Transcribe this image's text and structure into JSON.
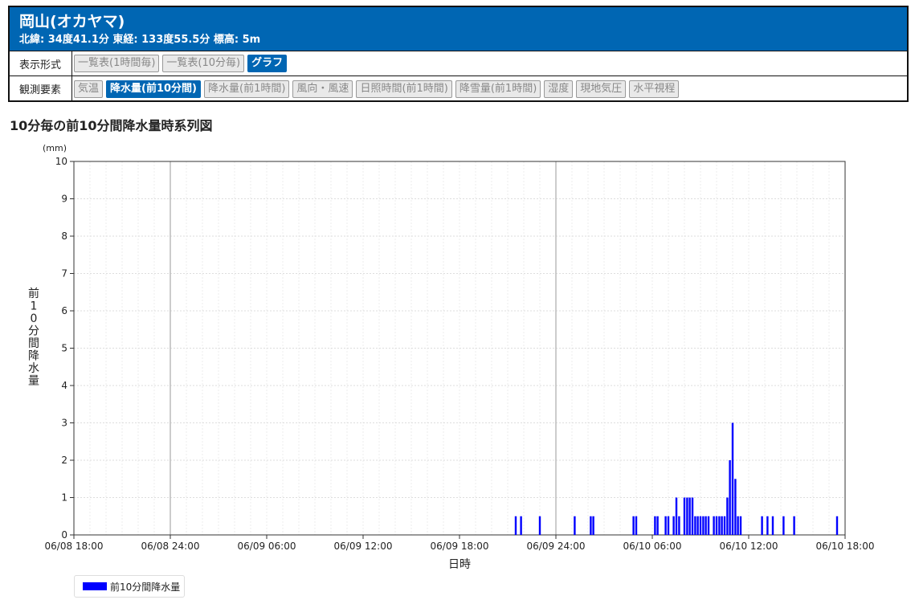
{
  "header": {
    "title": "岡山(オカヤマ)",
    "coords": "北緯: 34度41.1分 東経: 133度55.5分 標高: 5m"
  },
  "display_format": {
    "label": "表示形式",
    "buttons": [
      {
        "label": "一覧表(1時間毎)",
        "active": false
      },
      {
        "label": "一覧表(10分毎)",
        "active": false
      },
      {
        "label": "グラフ",
        "active": true
      }
    ]
  },
  "elements": {
    "label": "観測要素",
    "buttons": [
      {
        "label": "気温",
        "active": false
      },
      {
        "label": "降水量(前10分間)",
        "active": true
      },
      {
        "label": "降水量(前1時間)",
        "active": false
      },
      {
        "label": "風向・風速",
        "active": false
      },
      {
        "label": "日照時間(前1時間)",
        "active": false
      },
      {
        "label": "降雪量(前1時間)",
        "active": false
      },
      {
        "label": "湿度",
        "active": false
      },
      {
        "label": "現地気圧",
        "active": false
      },
      {
        "label": "水平視程",
        "active": false
      }
    ]
  },
  "chart_title": "10分毎の前10分間降水量時系列図",
  "colors": {
    "accent": "#0066b3",
    "series": "#0000ff"
  },
  "chart_data": {
    "type": "bar",
    "unit": "(mm)",
    "ylabel": "前10分間降水量",
    "xlabel": "日時",
    "ylim": [
      0,
      10
    ],
    "yticks": [
      0,
      1,
      2,
      3,
      4,
      5,
      6,
      7,
      8,
      9,
      10
    ],
    "x_start_hours": 0,
    "x_end_hours": 48,
    "xticks": [
      {
        "hours": 0,
        "label": "06/08 18:00"
      },
      {
        "hours": 6,
        "label": "06/08 24:00"
      },
      {
        "hours": 12,
        "label": "06/09 06:00"
      },
      {
        "hours": 18,
        "label": "06/09 12:00"
      },
      {
        "hours": 24,
        "label": "06/09 18:00"
      },
      {
        "hours": 30,
        "label": "06/09 24:00"
      },
      {
        "hours": 36,
        "label": "06/10 06:00"
      },
      {
        "hours": 42,
        "label": "06/10 12:00"
      },
      {
        "hours": 48,
        "label": "06/10 18:00"
      }
    ],
    "grid": true,
    "legend_position": "bottom-left",
    "series": [
      {
        "name": "前10分間降水量",
        "points": [
          {
            "x": 27.5,
            "y": 0.5
          },
          {
            "x": 27.83,
            "y": 0.5
          },
          {
            "x": 29.0,
            "y": 0.5
          },
          {
            "x": 31.17,
            "y": 0.5
          },
          {
            "x": 32.17,
            "y": 0.5
          },
          {
            "x": 32.33,
            "y": 0.5
          },
          {
            "x": 34.83,
            "y": 0.5
          },
          {
            "x": 35.0,
            "y": 0.5
          },
          {
            "x": 36.17,
            "y": 0.5
          },
          {
            "x": 36.33,
            "y": 0.5
          },
          {
            "x": 36.83,
            "y": 0.5
          },
          {
            "x": 37.0,
            "y": 0.5
          },
          {
            "x": 37.33,
            "y": 0.5
          },
          {
            "x": 37.5,
            "y": 1.0
          },
          {
            "x": 37.67,
            "y": 0.5
          },
          {
            "x": 38.0,
            "y": 1.0
          },
          {
            "x": 38.17,
            "y": 1.0
          },
          {
            "x": 38.33,
            "y": 1.0
          },
          {
            "x": 38.5,
            "y": 1.0
          },
          {
            "x": 38.67,
            "y": 0.5
          },
          {
            "x": 38.83,
            "y": 0.5
          },
          {
            "x": 39.0,
            "y": 0.5
          },
          {
            "x": 39.17,
            "y": 0.5
          },
          {
            "x": 39.33,
            "y": 0.5
          },
          {
            "x": 39.5,
            "y": 0.5
          },
          {
            "x": 39.83,
            "y": 0.5
          },
          {
            "x": 40.0,
            "y": 0.5
          },
          {
            "x": 40.17,
            "y": 0.5
          },
          {
            "x": 40.33,
            "y": 0.5
          },
          {
            "x": 40.5,
            "y": 0.5
          },
          {
            "x": 40.67,
            "y": 1.0
          },
          {
            "x": 40.83,
            "y": 2.0
          },
          {
            "x": 41.0,
            "y": 3.0
          },
          {
            "x": 41.17,
            "y": 1.5
          },
          {
            "x": 41.33,
            "y": 0.5
          },
          {
            "x": 41.5,
            "y": 0.5
          },
          {
            "x": 42.83,
            "y": 0.5
          },
          {
            "x": 43.17,
            "y": 0.5
          },
          {
            "x": 43.5,
            "y": 0.5
          },
          {
            "x": 44.17,
            "y": 0.5
          },
          {
            "x": 44.83,
            "y": 0.5
          },
          {
            "x": 47.5,
            "y": 0.5
          }
        ]
      }
    ]
  }
}
